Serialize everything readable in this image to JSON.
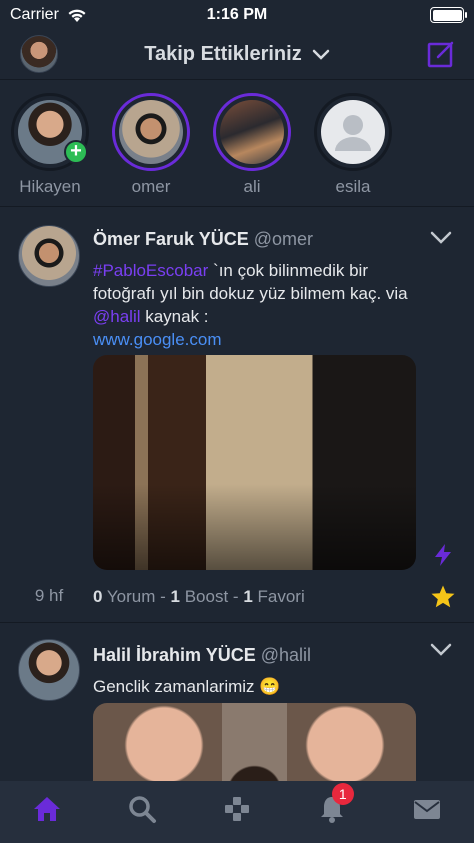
{
  "status_bar": {
    "carrier": "Carrier",
    "time": "1:16 PM"
  },
  "header": {
    "title": "Takip Ettikleriniz"
  },
  "stories": [
    {
      "name": "Hikayen"
    },
    {
      "name": "omer"
    },
    {
      "name": "ali"
    },
    {
      "name": "esila"
    }
  ],
  "posts": [
    {
      "author": "Ömer Faruk YÜCE",
      "handle": "@omer",
      "hashtag": "#PabloEscobar",
      "text1": " `ın çok bilinmedik bir fotoğrafı yıl bin dokuz yüz bilmem kaç. via ",
      "mention": "@halil",
      "text2": " kaynak :",
      "link": "www.google.com",
      "time": "9 hf",
      "comment_count": "0",
      "comment_label": "Yorum",
      "boost_count": "1",
      "boost_label": "Boost",
      "favorite_count": "1",
      "favorite_label": "Favori",
      "sep": " - "
    },
    {
      "author": "Halil İbrahim YÜCE",
      "handle": "@halil",
      "text": "Genclik zamanlarimiz 😁"
    }
  ],
  "tab_bar": {
    "notification_count": "1"
  },
  "colors": {
    "accent": "#6a2bd9",
    "link": "#4a8ff5",
    "background": "#1e2632",
    "tab_bar": "#262f3d",
    "badge": "#e8283d",
    "star": "#f5c518"
  }
}
